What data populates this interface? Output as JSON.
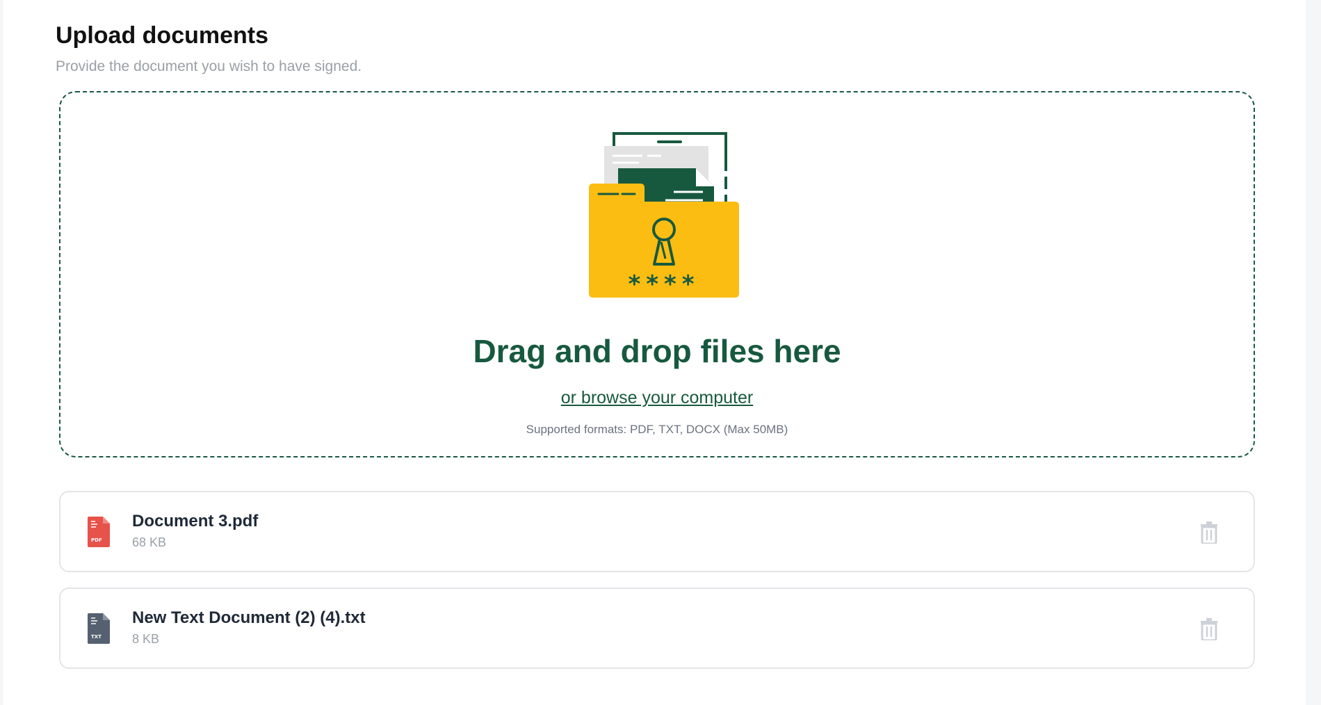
{
  "page": {
    "title": "Upload documents",
    "subtitle": "Provide the document you wish to have signed."
  },
  "dropzone": {
    "title": "Drag and drop files here",
    "browse_label": "or browse your computer",
    "formats_text": "Supported formats: PDF, TXT, DOCX (Max 50MB)",
    "illustration_icon": "locked-folder-icon",
    "password_mask": "****"
  },
  "files": [
    {
      "name": "Document 3.pdf",
      "size": "68 KB",
      "type_badge": "PDF",
      "icon": "pdf-file-icon",
      "color": "#e5534b"
    },
    {
      "name": "New Text Document (2) (4).txt",
      "size": "8 KB",
      "type_badge": "TXT",
      "icon": "txt-file-icon",
      "color": "#556070"
    }
  ],
  "colors": {
    "accent": "#17593f",
    "folder": "#fcbd12",
    "pdf": "#e5534b",
    "txt": "#556070",
    "muted": "#9aa0a6"
  }
}
